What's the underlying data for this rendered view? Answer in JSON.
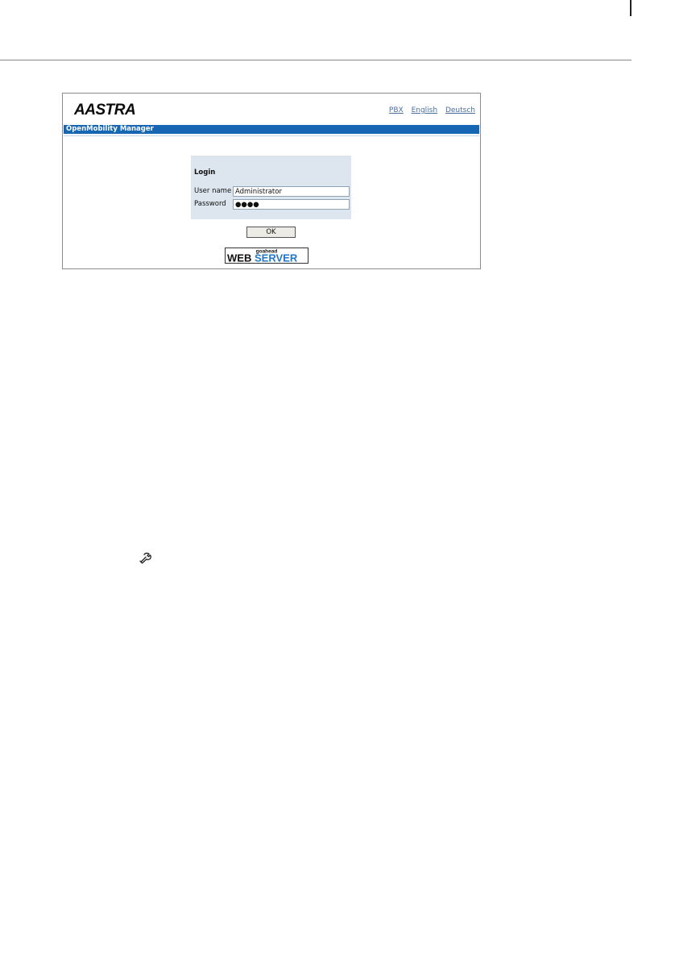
{
  "header": {
    "brand": "AASTRA",
    "links": [
      "PBX",
      "English",
      "Deutsch"
    ]
  },
  "title_bar": {
    "title": "OpenMobility Manager"
  },
  "login": {
    "heading": "Login",
    "username_label": "User name",
    "username_value": "Administrator",
    "password_label": "Password",
    "password_value": "●●●●",
    "ok_label": "OK"
  },
  "badge": {
    "small_text": "goahead",
    "web": "WEB",
    "server": "SERVER"
  },
  "icons": {
    "margin_icon": "wrench-icon"
  },
  "colors": {
    "title_bar": "#1566b3",
    "login_panel": "#dde6ee",
    "link": "#4a6fa5",
    "badge_blue": "#1f78c8"
  }
}
